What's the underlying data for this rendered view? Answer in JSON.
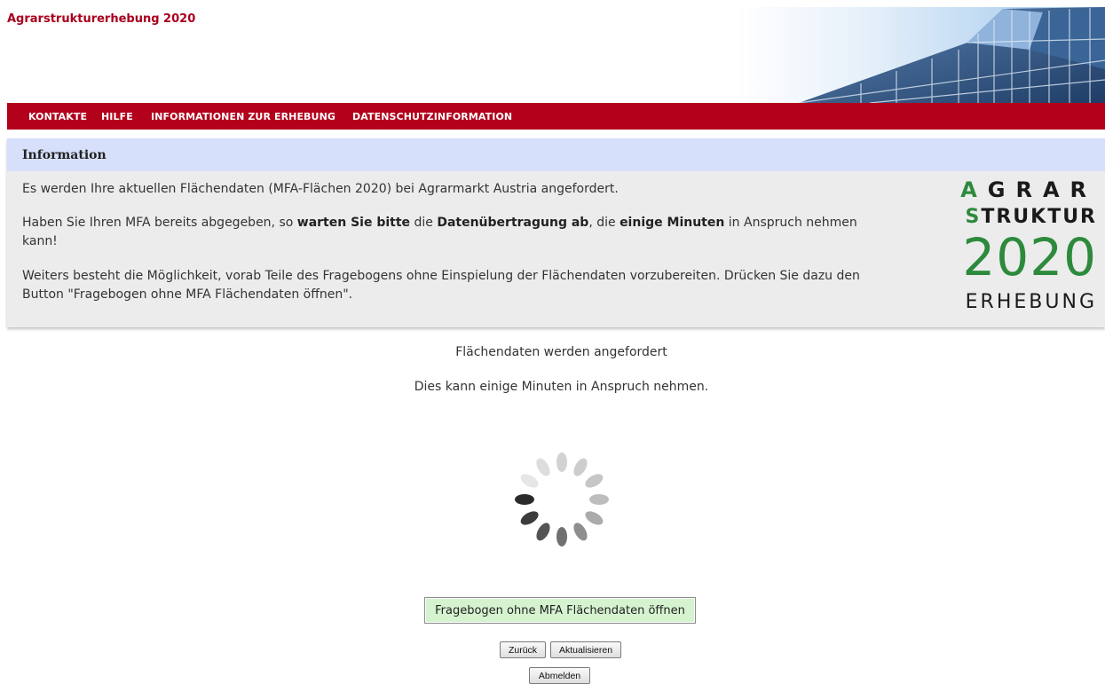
{
  "app": {
    "title": "Agrarstrukturerhebung 2020"
  },
  "nav": {
    "items": [
      {
        "label": "KONTAKTE"
      },
      {
        "label": "HILFE"
      },
      {
        "label": "INFORMATIONEN ZUR ERHEBUNG"
      },
      {
        "label": "DATENSCHUTZINFORMATION"
      }
    ]
  },
  "info": {
    "header": "Information",
    "p1": "Es werden Ihre aktuellen Flächendaten (MFA-Flächen 2020) bei Agrarmarkt Austria angefordert.",
    "p2": {
      "t1": "Haben Sie Ihren MFA bereits abgegeben, so ",
      "b1": "warten Sie bitte",
      "t2": " die ",
      "b2": "Datenübertragung ab",
      "t3": ", die ",
      "b3": "einige Minuten",
      "t4": " in Anspruch nehmen kann!"
    },
    "p3": "Weiters besteht die Möglichkeit, vorab Teile des Fragebogens ohne Einspielung der Flächendaten vorzubereiten. Drücken Sie dazu den Button \"Fragebogen ohne MFA Flächendaten öffnen\"."
  },
  "logo": {
    "agrar_first": "A",
    "agrar_rest": "GRAR",
    "struktur_first": "S",
    "struktur_rest": "TRUKTUR",
    "year": "2020",
    "erhebung": "ERHEBUNG"
  },
  "status": {
    "line1": "Flächendaten werden angefordert",
    "line2": "Dies kann einige Minuten in Anspruch nehmen."
  },
  "buttons": {
    "open_without_mfa": "Fragebogen ohne MFA Flächendaten öffnen",
    "back": "Zurück",
    "refresh": "Aktualisieren",
    "logout": "Abmelden"
  },
  "colors": {
    "brand_red": "#b3001b",
    "title_red": "#a8001e",
    "info_header_bg": "#d6e0fb",
    "logo_green": "#2d8a3d",
    "primary_button_bg": "#d6f3d0"
  },
  "icons": {
    "spinner": "loading-spinner-icon"
  }
}
